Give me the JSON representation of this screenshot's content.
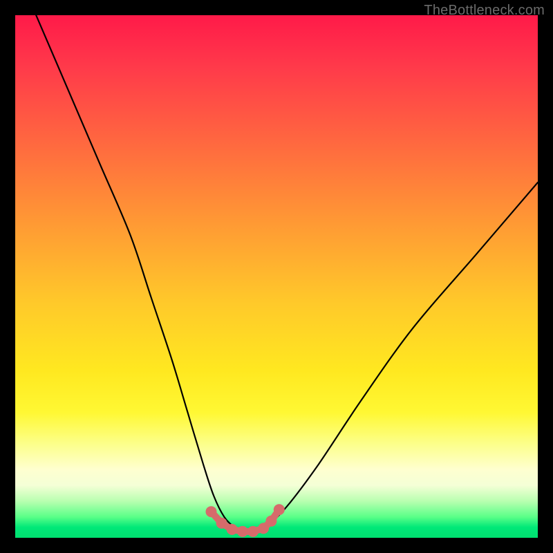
{
  "watermark": {
    "text": "TheBottleneck.com"
  },
  "colors": {
    "frame": "#000000",
    "gradient_top": "#ff1a49",
    "gradient_mid": "#ffe820",
    "gradient_bottom": "#00e070",
    "curve": "#000000",
    "marker": "#d66b6b"
  },
  "chart_data": {
    "type": "line",
    "title": "",
    "xlabel": "",
    "ylabel": "",
    "xlim": [
      0,
      100
    ],
    "ylim": [
      0,
      100
    ],
    "series": [
      {
        "name": "bottleneck-curve",
        "x": [
          4,
          10,
          16,
          22,
          26,
          30,
          33,
          36,
          38,
          40,
          42,
          44,
          46,
          48,
          52,
          58,
          66,
          76,
          88,
          100
        ],
        "y": [
          100,
          86,
          72,
          58,
          46,
          34,
          24,
          14,
          8,
          4,
          2,
          1,
          1,
          2,
          6,
          14,
          26,
          40,
          54,
          68
        ]
      }
    ],
    "markers": {
      "name": "flat-bottom-dots",
      "x": [
        37.5,
        39.5,
        41.5,
        43.5,
        45.5,
        47.5,
        49.0,
        50.5
      ],
      "y": [
        5.0,
        2.8,
        1.6,
        1.2,
        1.2,
        1.8,
        3.2,
        5.4
      ]
    }
  }
}
